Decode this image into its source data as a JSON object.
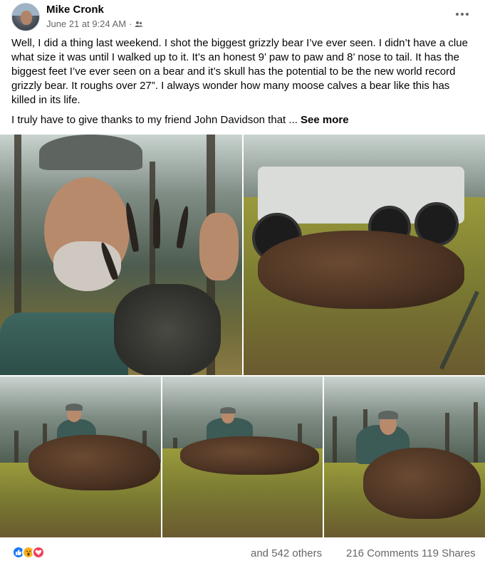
{
  "post": {
    "author": "Mike Cronk",
    "timestamp": "June 21 at 9:24 AM",
    "separator": "·",
    "audience_icon": "friends-icon",
    "more_icon": "more-horizontal-icon",
    "paragraph1": "Well, I did a thing last weekend. I shot the biggest grizzly bear I’ve ever seen. I didn’t have a clue what size it was until I walked up to it. It’s an honest 9’ paw to paw and 8’ nose to tail. It has the biggest feet I’ve ever seen on a bear and it’s skull has the potential to be the new world record grizzly bear. It roughs over 27”.  I always wonder how many moose calves a bear like this has killed in its life.",
    "paragraph2": "I truly have to give thanks to my friend John Davidson that ...",
    "see_more": "See more"
  },
  "footer": {
    "reactions": [
      "like-icon",
      "wow-icon",
      "love-icon"
    ],
    "others": "and 542 others",
    "comments": "216 Comments",
    "shares": "119 Shares"
  },
  "colors": {
    "text": "#050505",
    "secondary": "#65676b",
    "like": "#1877f2",
    "wow": "#f7b125",
    "love": "#f33e58"
  }
}
